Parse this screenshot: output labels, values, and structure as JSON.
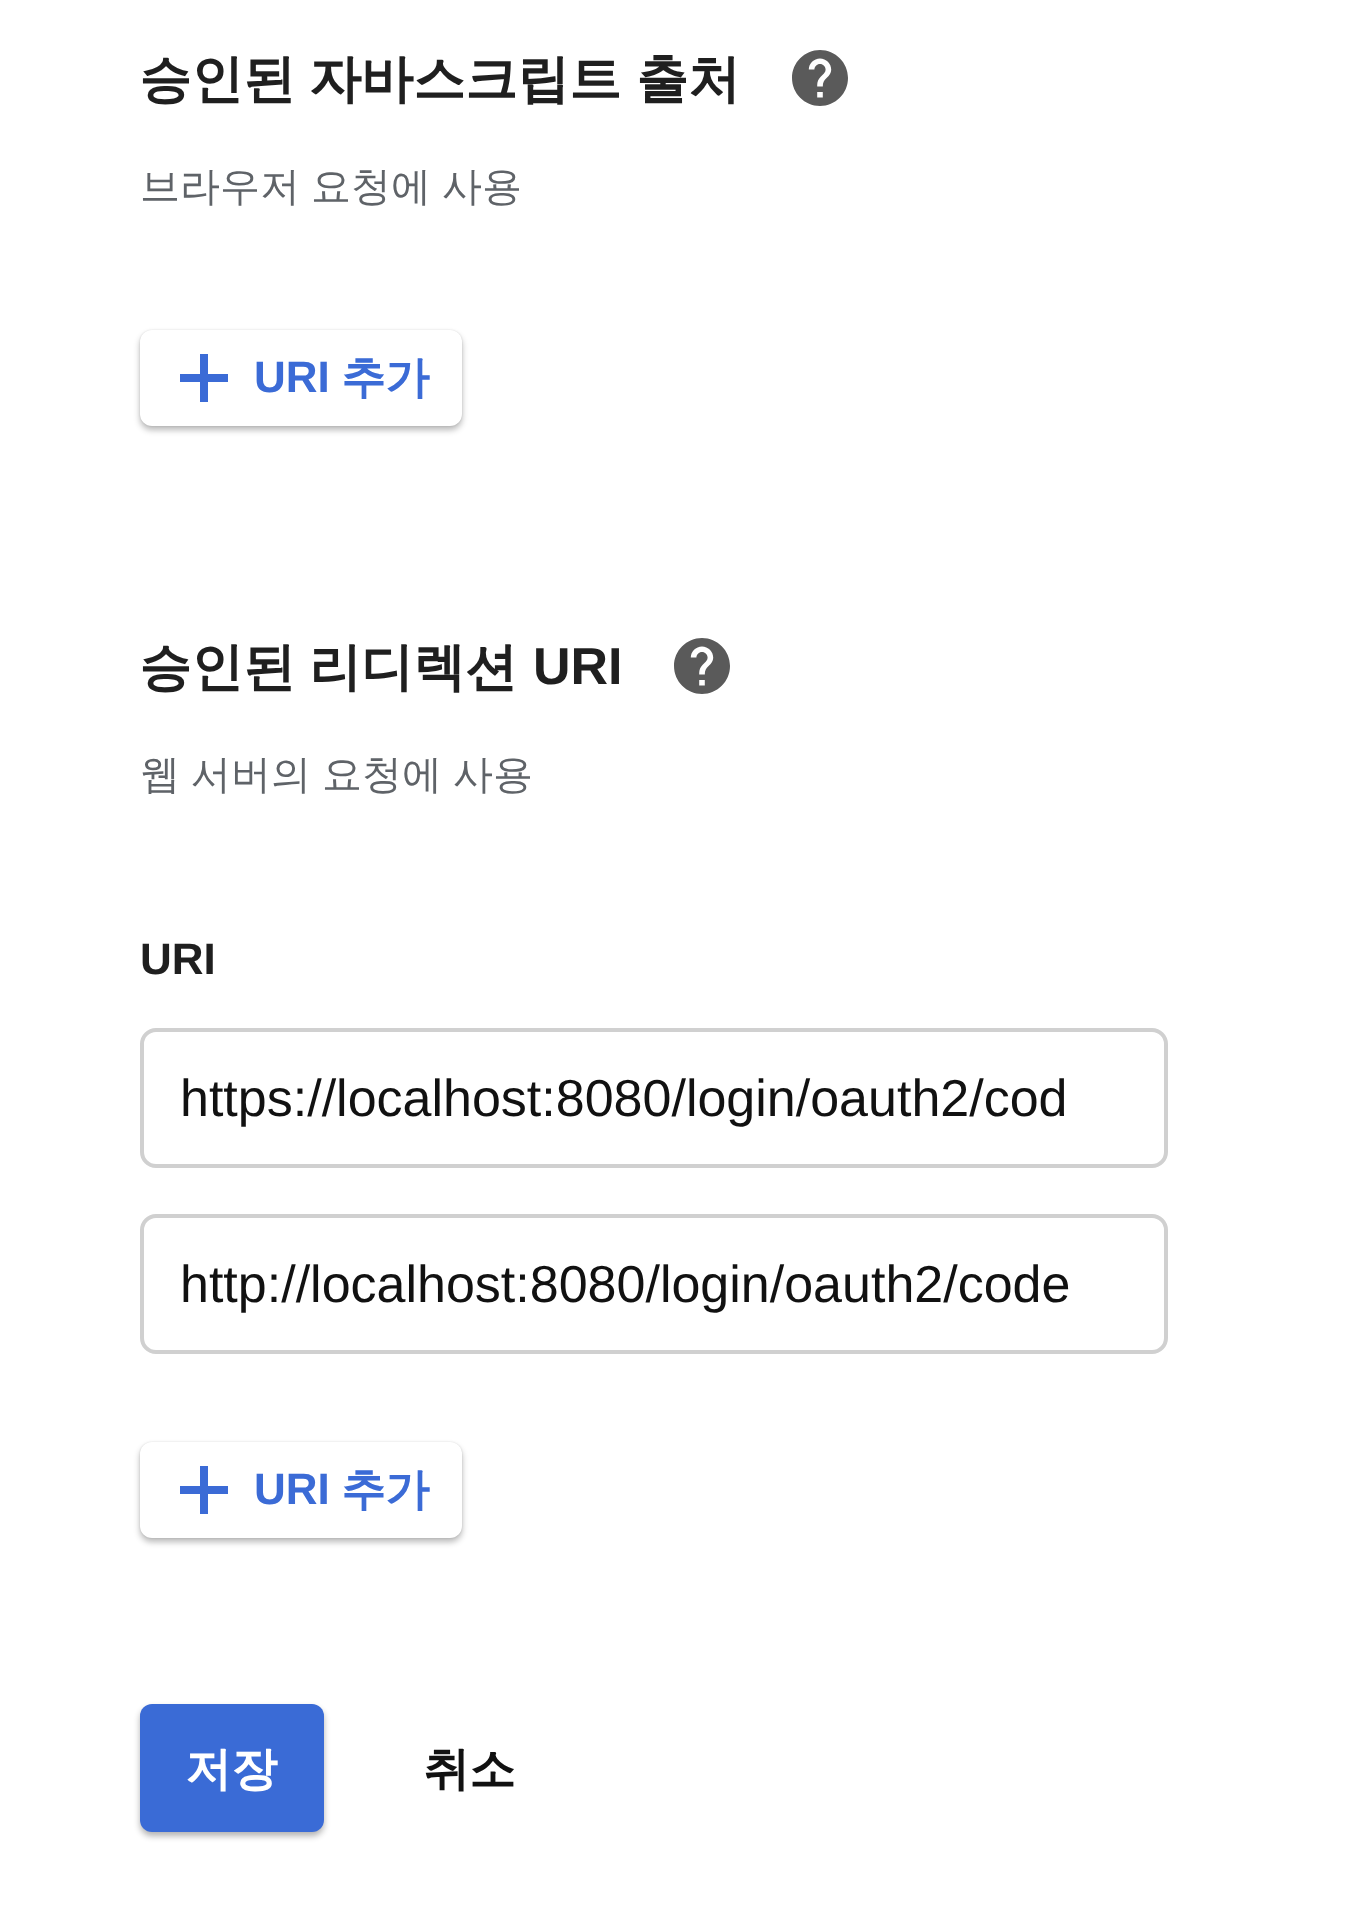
{
  "sections": [
    {
      "title": "승인된 자바스크립트 출처",
      "subtitle": "브라우저 요청에 사용",
      "add_button": "URI 추가"
    },
    {
      "title": "승인된 리디렉션 URI",
      "subtitle": "웹 서버의 요청에 사용",
      "field_label": "URI",
      "uris": [
        {
          "value": "https://localhost:8080/login/oauth2/cod"
        },
        {
          "value": "http://localhost:8080/login/oauth2/code"
        }
      ],
      "add_button": "URI 추가"
    }
  ],
  "actions": {
    "save": "저장",
    "cancel": "취소"
  }
}
